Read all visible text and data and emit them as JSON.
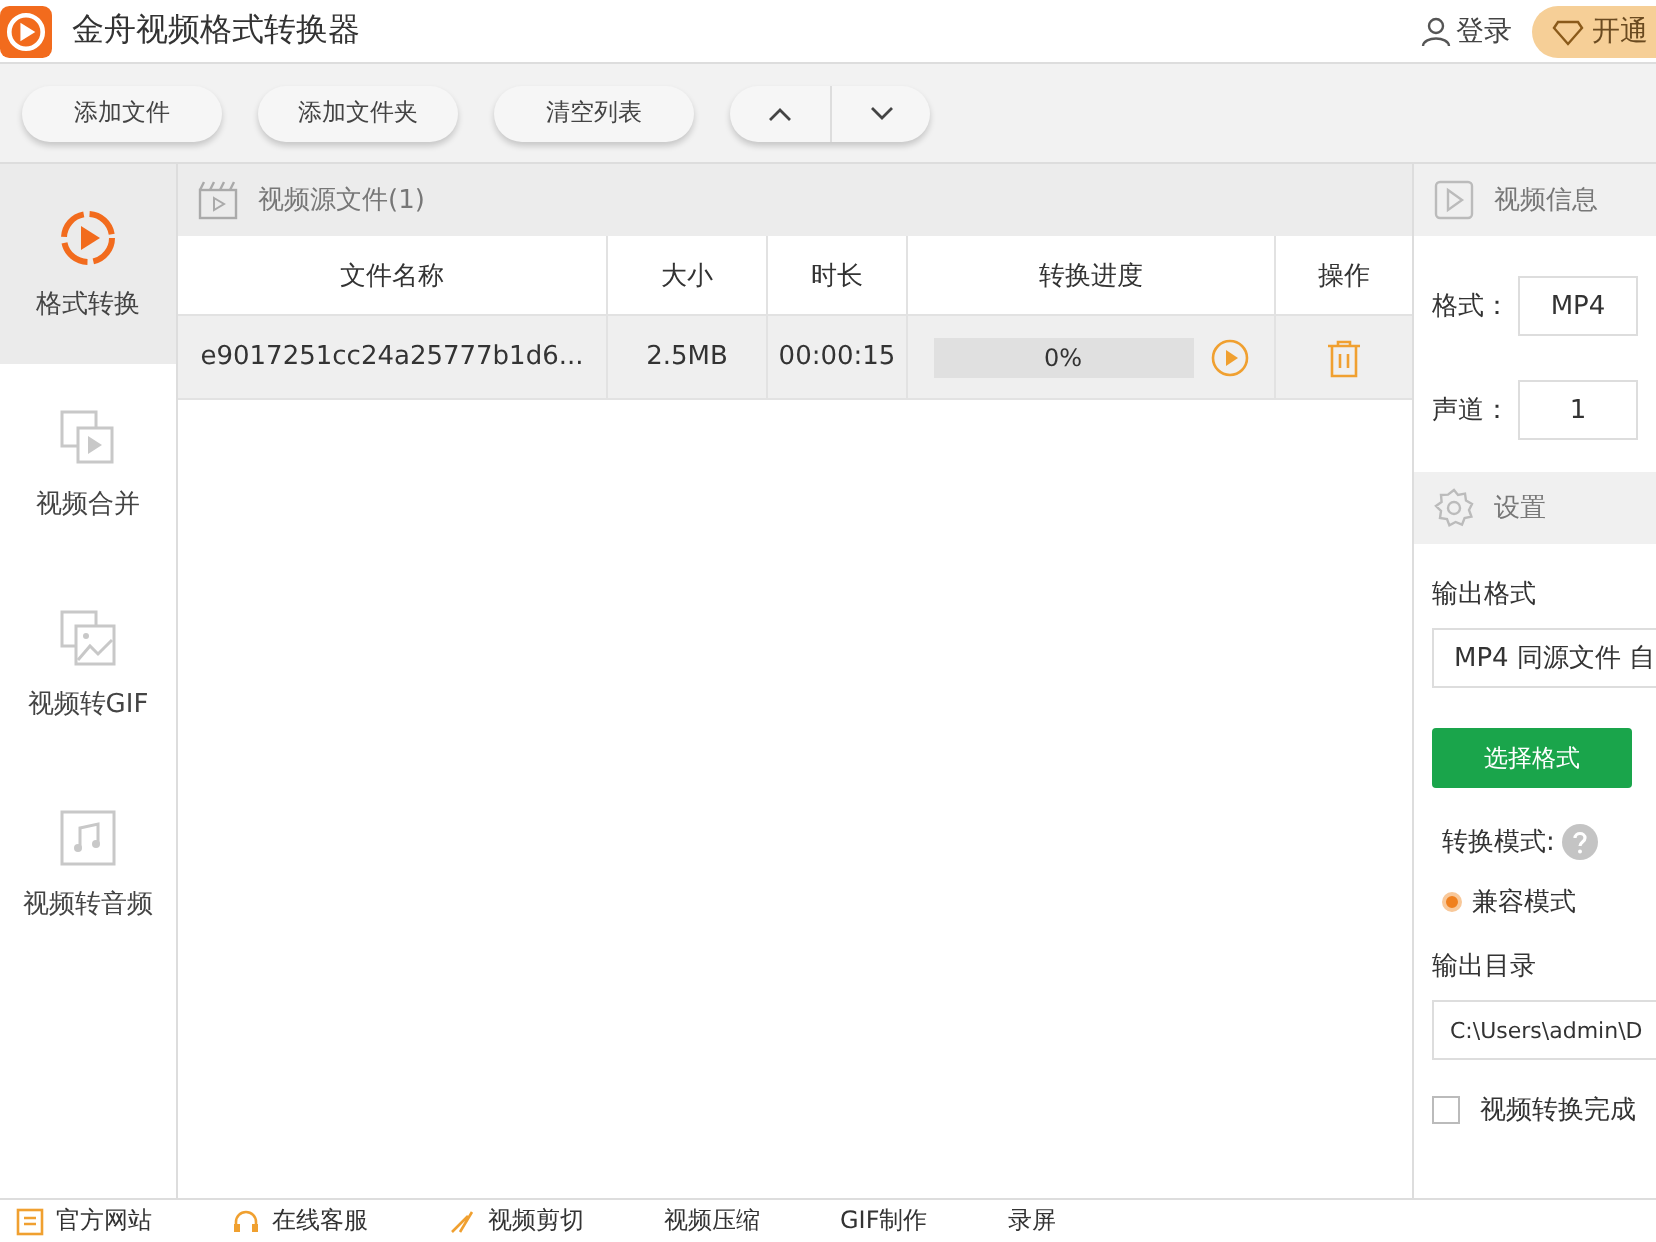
{
  "window": {
    "title": "金舟视频格式转换器",
    "login": "登录",
    "vip": "开通"
  },
  "toolbar": {
    "buttons": [
      "添加文件",
      "添加文件夹",
      "清空列表"
    ]
  },
  "sidebar": {
    "items": [
      {
        "label": "格式转换",
        "kind": "convert",
        "selected": true
      },
      {
        "label": "视频合并",
        "kind": "merge",
        "selected": false
      },
      {
        "label": "视频转GIF",
        "kind": "gif",
        "selected": false
      },
      {
        "label": "视频转音频",
        "kind": "audio",
        "selected": false
      }
    ]
  },
  "file_list": {
    "title": "视频源文件(1)",
    "columns": [
      "文件名称",
      "大小",
      "时长",
      "转换进度",
      "操作"
    ],
    "rows": [
      {
        "name": "e9017251cc24a25777b1d6...",
        "size": "2.5MB",
        "duration": "00:00:15",
        "progress": "0%",
        "level": 0
      }
    ]
  },
  "video_info": {
    "title": "视频信息",
    "fields": [
      {
        "label": "格式：",
        "value": "MP4"
      },
      {
        "label": "声道：",
        "value": "1"
      }
    ]
  },
  "settings": {
    "title": "设置",
    "output_format_label": "输出格式",
    "output_format": "MP4 同源文件 自",
    "choose_button": "选择格式",
    "mode_label": "转换模式:",
    "modes": [
      {
        "label": "兼容模式",
        "selected": true
      }
    ],
    "output_dir_label": "输出目录",
    "output_dir": "C:\\Users\\admin\\D",
    "after_done": {
      "label": "视频转换完成",
      "checked": false
    }
  },
  "bottom_bar": {
    "items": [
      {
        "label": "官方网站",
        "kind": "site"
      },
      {
        "label": "在线客服",
        "kind": "service"
      },
      {
        "label": "视频剪切",
        "kind": "cut"
      },
      {
        "label": "视频压缩",
        "kind": "plain"
      },
      {
        "label": "GIF制作",
        "kind": "plain"
      },
      {
        "label": "录屏",
        "kind": "plain"
      }
    ]
  }
}
